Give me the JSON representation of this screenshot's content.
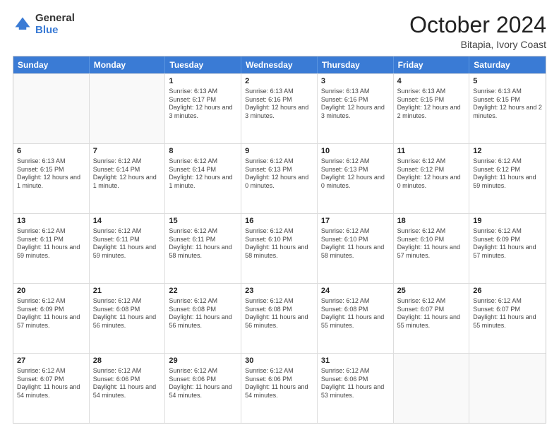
{
  "header": {
    "logo": {
      "line1": "General",
      "line2": "Blue"
    },
    "title": "October 2024",
    "location": "Bitapia, Ivory Coast"
  },
  "weekdays": [
    "Sunday",
    "Monday",
    "Tuesday",
    "Wednesday",
    "Thursday",
    "Friday",
    "Saturday"
  ],
  "rows": [
    [
      {
        "day": "",
        "info": ""
      },
      {
        "day": "",
        "info": ""
      },
      {
        "day": "1",
        "info": "Sunrise: 6:13 AM\nSunset: 6:17 PM\nDaylight: 12 hours and 3 minutes."
      },
      {
        "day": "2",
        "info": "Sunrise: 6:13 AM\nSunset: 6:16 PM\nDaylight: 12 hours and 3 minutes."
      },
      {
        "day": "3",
        "info": "Sunrise: 6:13 AM\nSunset: 6:16 PM\nDaylight: 12 hours and 3 minutes."
      },
      {
        "day": "4",
        "info": "Sunrise: 6:13 AM\nSunset: 6:15 PM\nDaylight: 12 hours and 2 minutes."
      },
      {
        "day": "5",
        "info": "Sunrise: 6:13 AM\nSunset: 6:15 PM\nDaylight: 12 hours and 2 minutes."
      }
    ],
    [
      {
        "day": "6",
        "info": "Sunrise: 6:13 AM\nSunset: 6:15 PM\nDaylight: 12 hours and 1 minute."
      },
      {
        "day": "7",
        "info": "Sunrise: 6:12 AM\nSunset: 6:14 PM\nDaylight: 12 hours and 1 minute."
      },
      {
        "day": "8",
        "info": "Sunrise: 6:12 AM\nSunset: 6:14 PM\nDaylight: 12 hours and 1 minute."
      },
      {
        "day": "9",
        "info": "Sunrise: 6:12 AM\nSunset: 6:13 PM\nDaylight: 12 hours and 0 minutes."
      },
      {
        "day": "10",
        "info": "Sunrise: 6:12 AM\nSunset: 6:13 PM\nDaylight: 12 hours and 0 minutes."
      },
      {
        "day": "11",
        "info": "Sunrise: 6:12 AM\nSunset: 6:12 PM\nDaylight: 12 hours and 0 minutes."
      },
      {
        "day": "12",
        "info": "Sunrise: 6:12 AM\nSunset: 6:12 PM\nDaylight: 11 hours and 59 minutes."
      }
    ],
    [
      {
        "day": "13",
        "info": "Sunrise: 6:12 AM\nSunset: 6:11 PM\nDaylight: 11 hours and 59 minutes."
      },
      {
        "day": "14",
        "info": "Sunrise: 6:12 AM\nSunset: 6:11 PM\nDaylight: 11 hours and 59 minutes."
      },
      {
        "day": "15",
        "info": "Sunrise: 6:12 AM\nSunset: 6:11 PM\nDaylight: 11 hours and 58 minutes."
      },
      {
        "day": "16",
        "info": "Sunrise: 6:12 AM\nSunset: 6:10 PM\nDaylight: 11 hours and 58 minutes."
      },
      {
        "day": "17",
        "info": "Sunrise: 6:12 AM\nSunset: 6:10 PM\nDaylight: 11 hours and 58 minutes."
      },
      {
        "day": "18",
        "info": "Sunrise: 6:12 AM\nSunset: 6:10 PM\nDaylight: 11 hours and 57 minutes."
      },
      {
        "day": "19",
        "info": "Sunrise: 6:12 AM\nSunset: 6:09 PM\nDaylight: 11 hours and 57 minutes."
      }
    ],
    [
      {
        "day": "20",
        "info": "Sunrise: 6:12 AM\nSunset: 6:09 PM\nDaylight: 11 hours and 57 minutes."
      },
      {
        "day": "21",
        "info": "Sunrise: 6:12 AM\nSunset: 6:08 PM\nDaylight: 11 hours and 56 minutes."
      },
      {
        "day": "22",
        "info": "Sunrise: 6:12 AM\nSunset: 6:08 PM\nDaylight: 11 hours and 56 minutes."
      },
      {
        "day": "23",
        "info": "Sunrise: 6:12 AM\nSunset: 6:08 PM\nDaylight: 11 hours and 56 minutes."
      },
      {
        "day": "24",
        "info": "Sunrise: 6:12 AM\nSunset: 6:08 PM\nDaylight: 11 hours and 55 minutes."
      },
      {
        "day": "25",
        "info": "Sunrise: 6:12 AM\nSunset: 6:07 PM\nDaylight: 11 hours and 55 minutes."
      },
      {
        "day": "26",
        "info": "Sunrise: 6:12 AM\nSunset: 6:07 PM\nDaylight: 11 hours and 55 minutes."
      }
    ],
    [
      {
        "day": "27",
        "info": "Sunrise: 6:12 AM\nSunset: 6:07 PM\nDaylight: 11 hours and 54 minutes."
      },
      {
        "day": "28",
        "info": "Sunrise: 6:12 AM\nSunset: 6:06 PM\nDaylight: 11 hours and 54 minutes."
      },
      {
        "day": "29",
        "info": "Sunrise: 6:12 AM\nSunset: 6:06 PM\nDaylight: 11 hours and 54 minutes."
      },
      {
        "day": "30",
        "info": "Sunrise: 6:12 AM\nSunset: 6:06 PM\nDaylight: 11 hours and 54 minutes."
      },
      {
        "day": "31",
        "info": "Sunrise: 6:12 AM\nSunset: 6:06 PM\nDaylight: 11 hours and 53 minutes."
      },
      {
        "day": "",
        "info": ""
      },
      {
        "day": "",
        "info": ""
      }
    ]
  ]
}
